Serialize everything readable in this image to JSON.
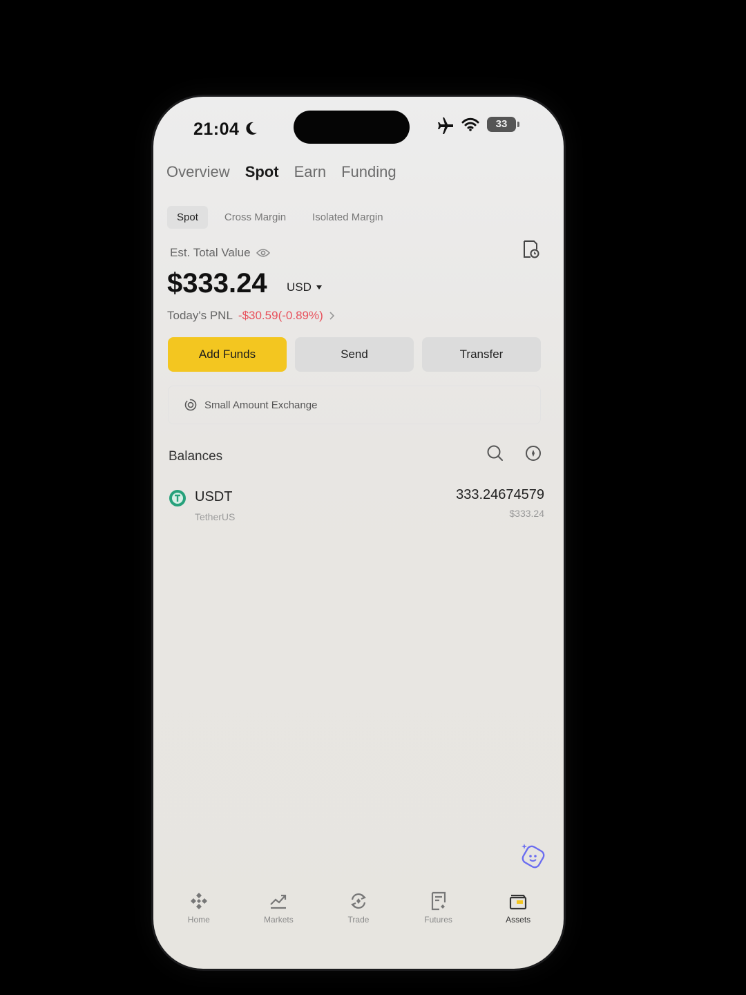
{
  "status": {
    "time": "21:04",
    "battery": "33"
  },
  "tabs": [
    {
      "label": "Overview"
    },
    {
      "label": "Spot"
    },
    {
      "label": "Earn"
    },
    {
      "label": "Funding"
    }
  ],
  "subtabs": [
    {
      "label": "Spot"
    },
    {
      "label": "Cross Margin"
    },
    {
      "label": "Isolated Margin"
    }
  ],
  "overview": {
    "est_label": "Est. Total Value",
    "total": "$333.24",
    "currency": "USD",
    "pnl_label": "Today's PNL",
    "pnl_value": "-$30.59(-0.89%)"
  },
  "actions": {
    "add_funds": "Add Funds",
    "send": "Send",
    "transfer": "Transfer"
  },
  "small_exchange": "Small Amount Exchange",
  "balances": {
    "title": "Balances",
    "items": [
      {
        "symbol": "USDT",
        "name": "TetherUS",
        "amount": "333.24674579",
        "fiat": "$333.24"
      }
    ]
  },
  "nav": [
    {
      "label": "Home",
      "icon": "home-icon"
    },
    {
      "label": "Markets",
      "icon": "markets-icon"
    },
    {
      "label": "Trade",
      "icon": "trade-icon"
    },
    {
      "label": "Futures",
      "icon": "futures-icon"
    },
    {
      "label": "Assets",
      "icon": "assets-icon"
    }
  ],
  "colors": {
    "accent": "#f3c620",
    "negative": "#e8505b",
    "coin": "#26a17b"
  }
}
